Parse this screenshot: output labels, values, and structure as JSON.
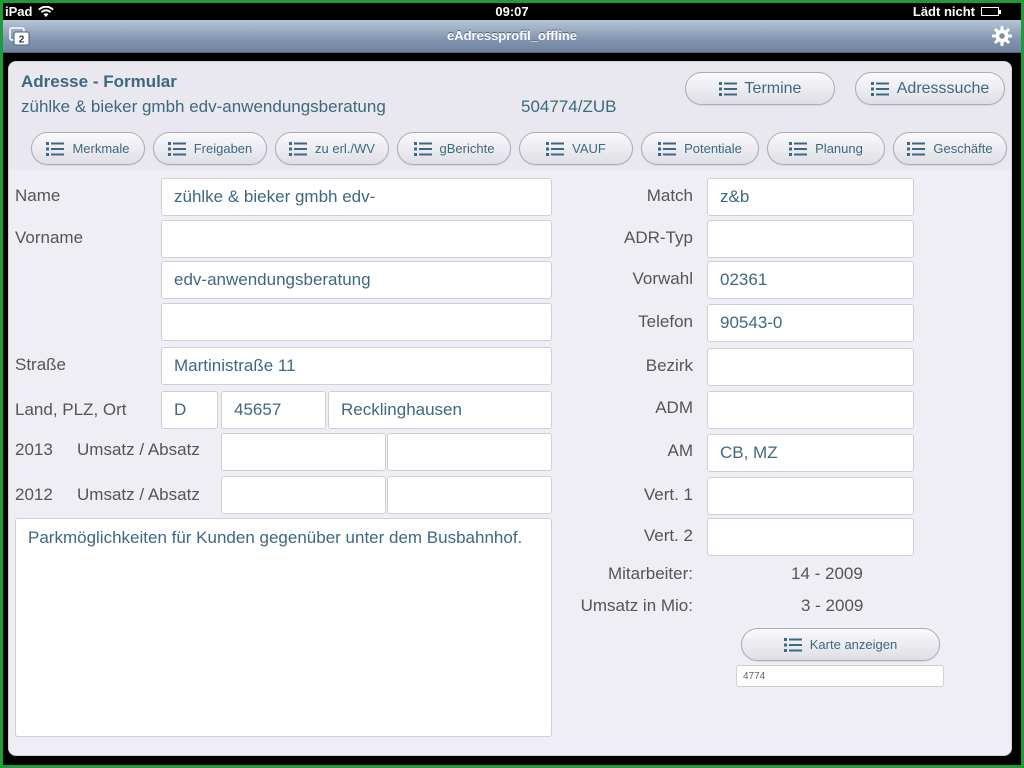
{
  "status": {
    "device": "iPad",
    "time": "09:07",
    "charging": "Lädt nicht"
  },
  "window": {
    "title": "eAdressprofil_offline",
    "tab_count": "2"
  },
  "header": {
    "form_title": "Adresse - Formular",
    "company": "zühlke & bieker gmbh edv-anwendungsberatung",
    "id": "504774/ZUB",
    "btn_termine": "Termine",
    "btn_adresssuche": "Adresssuche"
  },
  "toolbar": {
    "merkmale": "Merkmale",
    "freigaben": "Freigaben",
    "zu_erl": "zu erl./WV",
    "gberichte": "gBerichte",
    "vauf": "VAUF",
    "potentiale": "Potentiale",
    "planung": "Planung",
    "geschaefte": "Geschäfte"
  },
  "form": {
    "name_label": "Name",
    "name_value": "zühlke & bieker gmbh edv-",
    "vorname_label": "Vorname",
    "vorname_value": "",
    "line3_value": "edv-anwendungsberatung",
    "line4_value": "",
    "strasse_label": "Straße",
    "strasse_value": "Martinistraße 11",
    "land_label": "Land, PLZ, Ort",
    "land_value": "D",
    "plz_value": "45657",
    "ort_value": "Recklinghausen",
    "year1": "2013",
    "year2": "2012",
    "umsatz_label": "Umsatz / Absatz",
    "umsatz_2013": "",
    "absatz_2013": "",
    "umsatz_2012": "",
    "absatz_2012": "",
    "notes": "Parkmöglichkeiten für Kunden gegenüber unter dem Busbahnhof."
  },
  "right": {
    "match_label": "Match",
    "match_value": "z&b",
    "adrtyp_label": "ADR-Typ",
    "adrtyp_value": "",
    "vorwahl_label": "Vorwahl",
    "vorwahl_value": "02361",
    "telefon_label": "Telefon",
    "telefon_value": "90543-0",
    "bezirk_label": "Bezirk",
    "bezirk_value": "",
    "adm_label": "ADM",
    "adm_value": "",
    "am_label": "AM",
    "am_value": "CB, MZ",
    "vert1_label": "Vert. 1",
    "vert1_value": "",
    "vert2_label": "Vert. 2",
    "vert2_value": "",
    "mitarbeiter_label": "Mitarbeiter:",
    "mitarbeiter_value": "14  - 2009",
    "umsatz_mio_label": "Umsatz in Mio:",
    "umsatz_mio_value": "3  - 2009",
    "karte_button": "Karte anzeigen",
    "map_value": "4774"
  },
  "colors": {
    "accent_text": "#3e6880",
    "titlebar": "#8396b0",
    "border_green": "#1f9a3c"
  }
}
